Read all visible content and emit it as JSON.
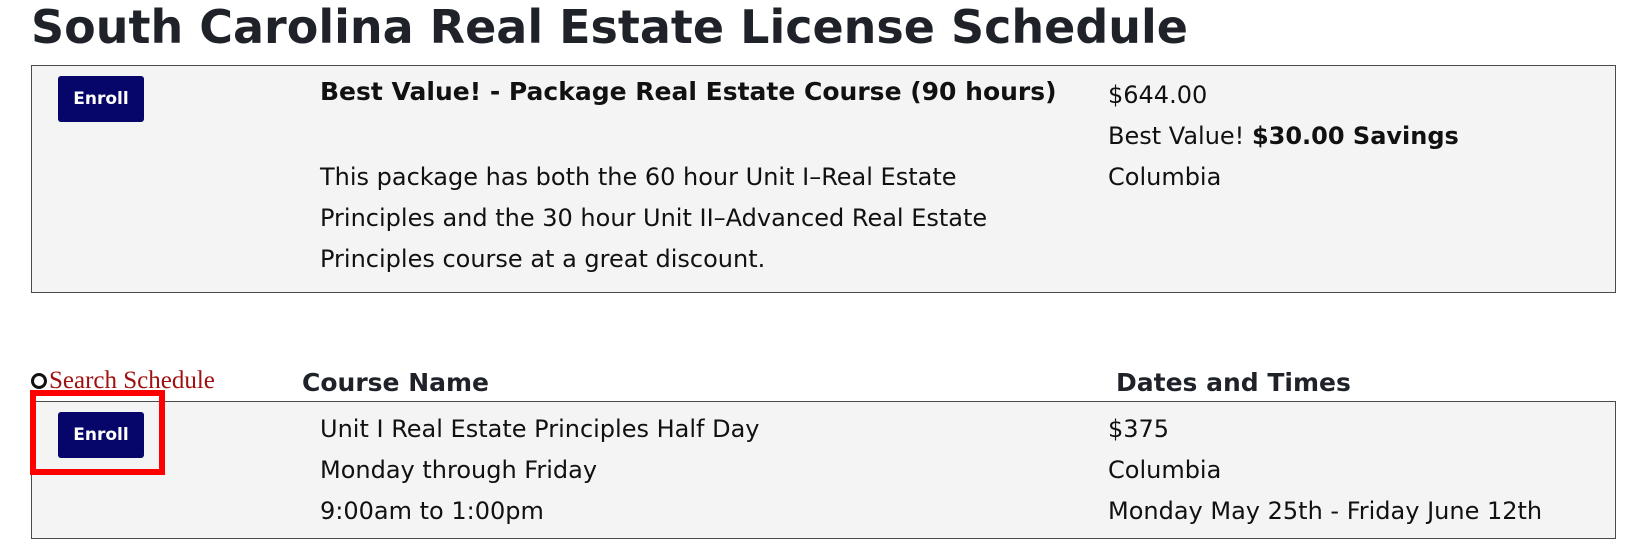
{
  "page": {
    "title": "South Carolina Real Estate License Schedule"
  },
  "package_card": {
    "enroll_label": "Enroll",
    "title": "Best Value! - Package Real Estate Course (90 hours)",
    "description_lines": [
      "This package has both the 60 hour Unit I–Real Estate",
      "Principles and the 30 hour Unit II–Advanced Real Estate",
      "Principles course at a great discount."
    ],
    "price": "$644.00",
    "savings_prefix": "Best Value! ",
    "savings_amount": "$30.00 Savings",
    "location": "Columbia"
  },
  "schedule": {
    "search_label": "Search Schedule",
    "headers": {
      "course_name": "Course Name",
      "dates_and_times": "Dates and Times"
    },
    "rows": [
      {
        "enroll_label": "Enroll",
        "course_lines": [
          "Unit I Real Estate Principles Half Day",
          "Monday through Friday",
          "9:00am to 1:00pm"
        ],
        "price": "$375",
        "location": "Columbia",
        "dates": "Monday May 25th - Friday June 12th"
      }
    ]
  },
  "colors": {
    "enroll_button": "#06066a",
    "card_background": "#f4f4f4",
    "search_link": "#a01010",
    "highlight": "#ff0000"
  },
  "icons": {
    "search": "search-icon"
  }
}
